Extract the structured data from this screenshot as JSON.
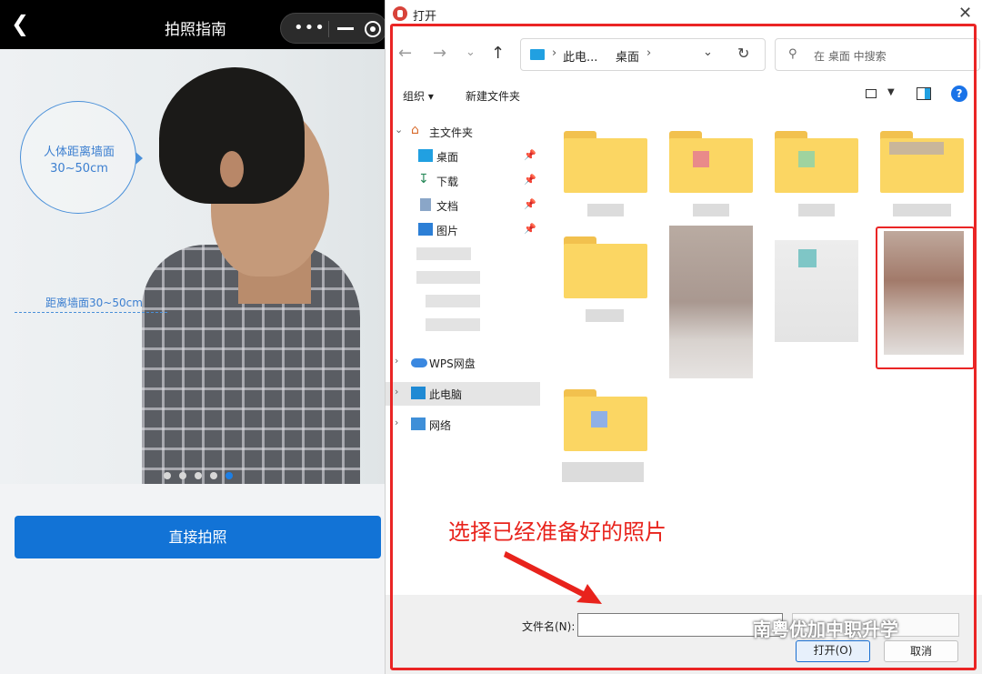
{
  "left": {
    "title": "拍照指南",
    "bubble_line1": "人体距离墙面",
    "bubble_line2": "30~50cm",
    "distance_label": "距离墙面30~50cm",
    "pager_count": 5,
    "pager_active": 5,
    "shoot_button": "直接拍照"
  },
  "dialog": {
    "title": "打开",
    "breadcrumb": [
      "此电...",
      "桌面"
    ],
    "search_placeholder": "在 桌面 中搜索",
    "toolbar": {
      "organize": "组织 ▾",
      "new_folder": "新建文件夹"
    },
    "nav": {
      "home": "主文件夹",
      "quick": [
        {
          "label": "桌面",
          "icon": "desktop-icon"
        },
        {
          "label": "下载",
          "icon": "download-icon"
        },
        {
          "label": "文档",
          "icon": "document-icon"
        },
        {
          "label": "图片",
          "icon": "picture-icon"
        }
      ],
      "wps": "WPS网盘",
      "this_pc": "此电脑",
      "network": "网络"
    },
    "filename_label": "文件名(N):",
    "filename_value": "",
    "open_button": "打开(O)",
    "cancel_button": "取消"
  },
  "annotation": {
    "instruction": "选择已经准备好的照片",
    "watermark": "南粤优加中职升学",
    "highlight_color": "#ea2525"
  }
}
